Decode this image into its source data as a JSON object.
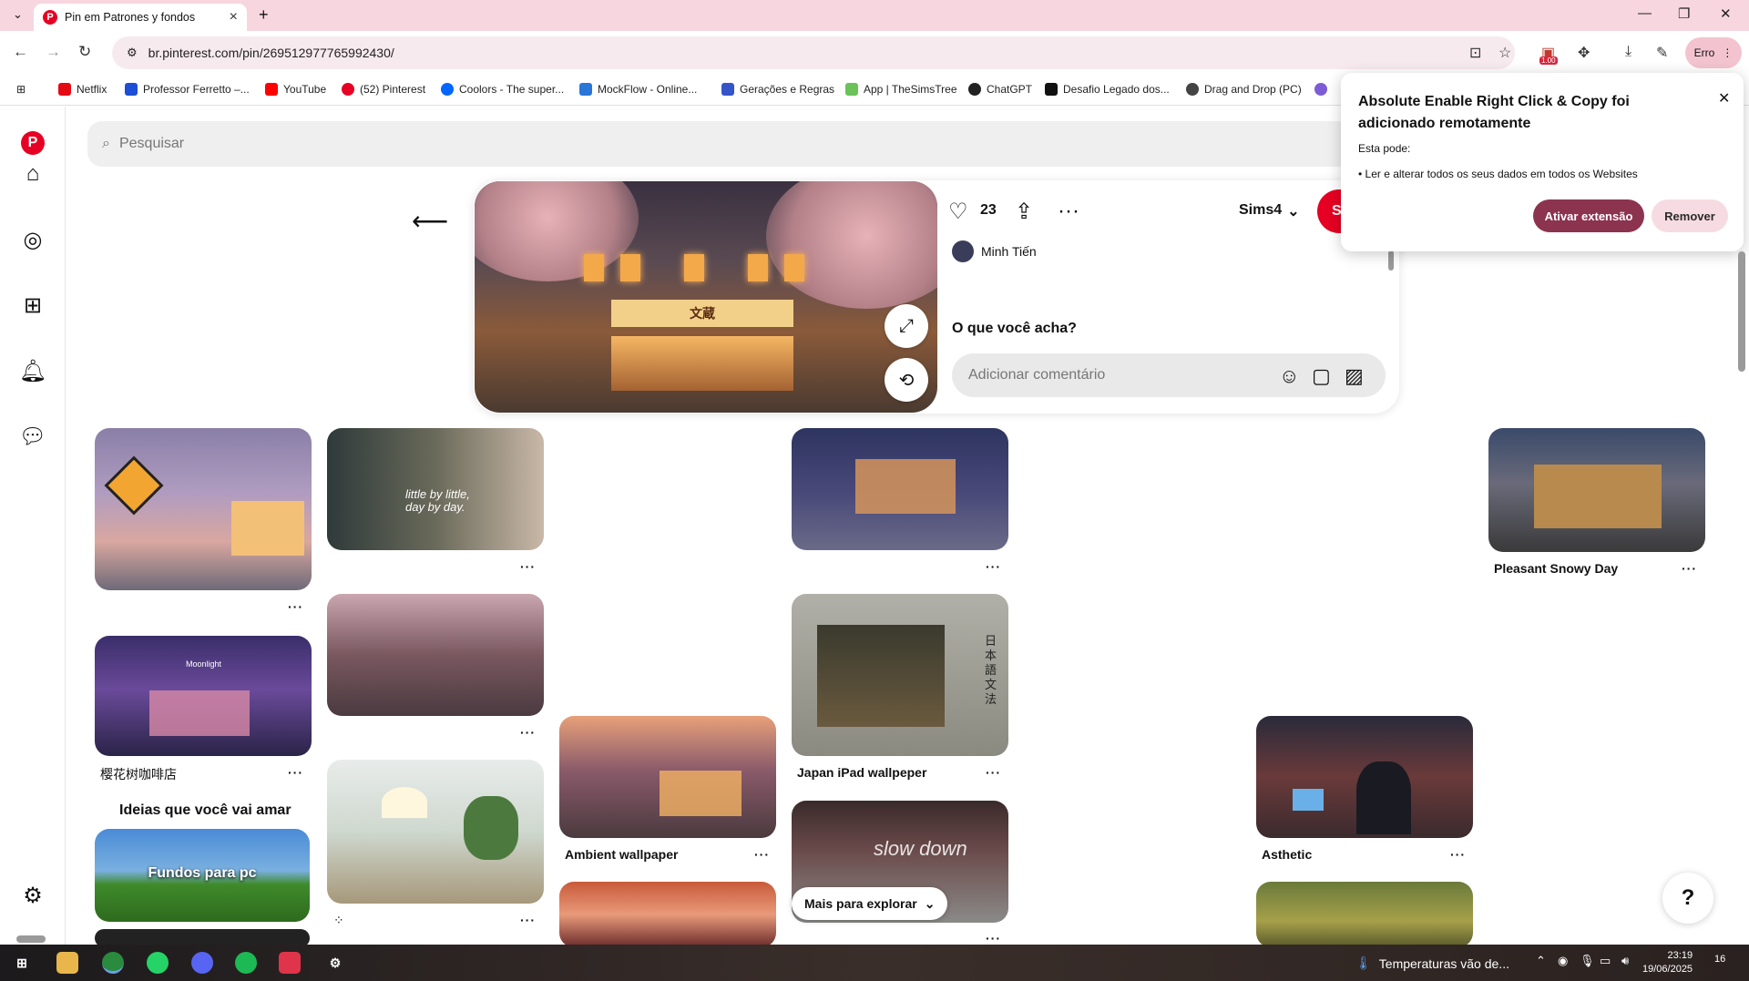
{
  "browser": {
    "tab_title": "Pin em Patrones y fondos",
    "url": "br.pinterest.com/pin/269512977765992430/",
    "profile_label": "Erro",
    "badge": "1.00",
    "bookmarks": [
      {
        "label": "Netflix",
        "color": "#e50914"
      },
      {
        "label": "Professor Ferretto –...",
        "color": "#1c4fd6"
      },
      {
        "label": "YouTube",
        "color": "#ff0000"
      },
      {
        "label": "(52) Pinterest",
        "color": "#e60023"
      },
      {
        "label": "Coolors - The super...",
        "color": "#0066ff"
      },
      {
        "label": "MockFlow - Online...",
        "color": "#2a76d8"
      },
      {
        "label": "Gerações e Regras",
        "color": "#3455c9"
      },
      {
        "label": "App | TheSimsTree",
        "color": "#6ac259"
      },
      {
        "label": "ChatGPT",
        "color": "#222222"
      },
      {
        "label": "Desafio Legado dos...",
        "color": "#111111"
      },
      {
        "label": "Drag and Drop (PC)",
        "color": "#444444"
      }
    ]
  },
  "search": {
    "placeholder": "Pesquisar"
  },
  "pin": {
    "sign_text": "文蔵",
    "likes": "23",
    "board": "Sims4",
    "save_label": "S",
    "author": "Minh Tiến",
    "comment_prompt": "O que você acha?",
    "comment_placeholder": "Adicionar comentário"
  },
  "grid": {
    "titles": {
      "sakura_cafe": "樱花树咖啡店",
      "pleasant": "Pleasant Snowy Day",
      "japan": "Japan iPad wallpeper",
      "ambient": "Ambient wallpaper",
      "asthetic": "Asthetic"
    },
    "ideas_title": "Ideias que você vai amar",
    "fundos_label": "Fundos para pc",
    "more_explore": "Mais para explorar",
    "dots": "···",
    "kiki_text": "little by little, day by day.",
    "moonlight": "Moonlight",
    "slow_down": "slow down",
    "japanese_vertical": "日本語文法"
  },
  "extension_popup": {
    "title": "Absolute Enable Right Click & Copy foi adicionado remotamente",
    "can_do": "Esta pode:",
    "permission": "• Ler e alterar todos os seus dados em todos os Websites",
    "enable": "Ativar extensão",
    "remove": "Remover"
  },
  "taskbar": {
    "weather": "Temperaturas vão de...",
    "time": "23:19",
    "date": "19/06/2025",
    "notifications": "16"
  },
  "colors": {
    "pinterest_red": "#e60023",
    "tab_bar": "#f7d6df",
    "accent": "#8c3350"
  },
  "icons": [
    "home-icon",
    "compass-icon",
    "plus-icon",
    "bell-icon",
    "message-icon",
    "settings-icon",
    "heart-icon",
    "share-icon",
    "more-icon",
    "expand-icon",
    "visual-search-icon",
    "emoji-icon",
    "sticker-icon",
    "image-icon",
    "help-icon"
  ]
}
